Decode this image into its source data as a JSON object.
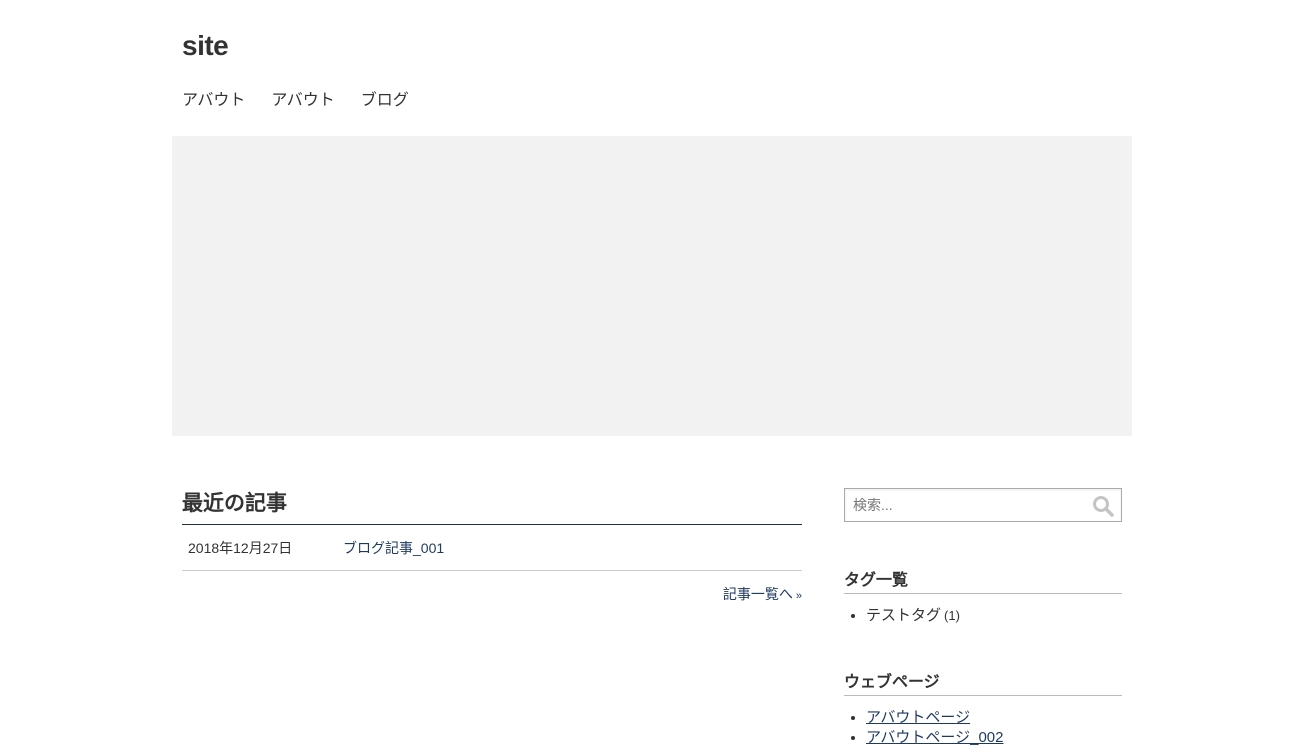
{
  "header": {
    "site_title": "site",
    "nav": [
      "アバウト",
      "アバウト",
      "ブログ"
    ]
  },
  "hero": {
    "background": "#f2f2f2"
  },
  "recent_posts": {
    "heading": "最近の記事",
    "posts": [
      {
        "date": "2018年12月27日",
        "title": "ブログ記事_001"
      }
    ],
    "more_link": "記事一覧へ",
    "more_arrow": "»"
  },
  "sidebar": {
    "search": {
      "placeholder": "検索...",
      "icon": "search-icon"
    },
    "tags": {
      "heading": "タグ一覧",
      "items": [
        {
          "label": "テストタグ",
          "count": "(1)"
        }
      ]
    },
    "webpages": {
      "heading": "ウェブページ",
      "items": [
        "アバウトページ",
        "アバウトページ_002"
      ]
    }
  },
  "colors": {
    "text": "#333333",
    "link": "#1f3a5f",
    "heading_rule": "#1f3044"
  }
}
